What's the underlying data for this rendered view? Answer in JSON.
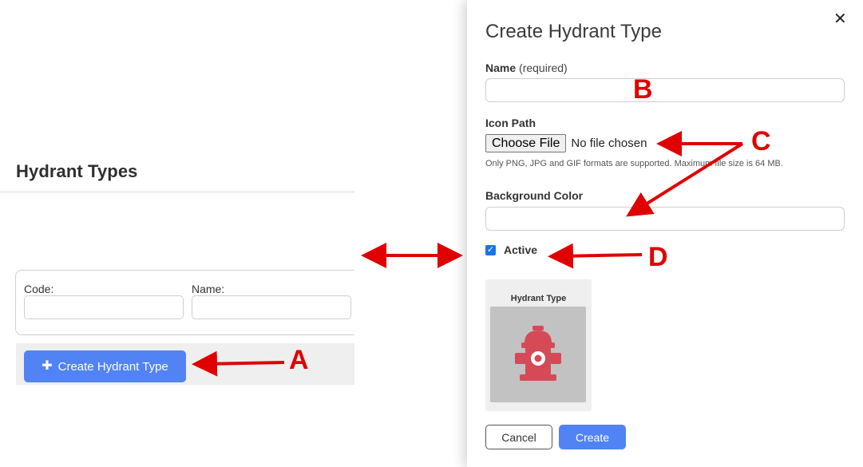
{
  "page": {
    "title": "Hydrant Types",
    "filters": {
      "code_label": "Code:",
      "code_value": "",
      "name_label": "Name:",
      "name_value": ""
    },
    "create_button": {
      "icon": "plus-icon",
      "label": "Create Hydrant Type"
    }
  },
  "modal": {
    "title": "Create Hydrant Type",
    "close_icon": "close-icon",
    "close_glyph": "✕",
    "name": {
      "label": "Name",
      "required": "(required)",
      "value": ""
    },
    "icon_path": {
      "label": "Icon Path",
      "button": "Choose File",
      "status": "No file chosen",
      "hint": "Only PNG, JPG and GIF formats are supported. Maximum file size is 64 MB."
    },
    "background_color": {
      "label": "Background Color",
      "value": ""
    },
    "active": {
      "label": "Active",
      "checked": true
    },
    "preview": {
      "title": "Hydrant Type",
      "icon": "fire-hydrant-icon",
      "tile_color": "#c2c2c2",
      "icon_color": "#d64a58"
    },
    "cancel_label": "Cancel",
    "create_label": "Create"
  },
  "annotations": {
    "color": "#e00000",
    "labels": [
      "A",
      "B",
      "C",
      "D"
    ]
  },
  "colors": {
    "primary": "#5183f5"
  }
}
